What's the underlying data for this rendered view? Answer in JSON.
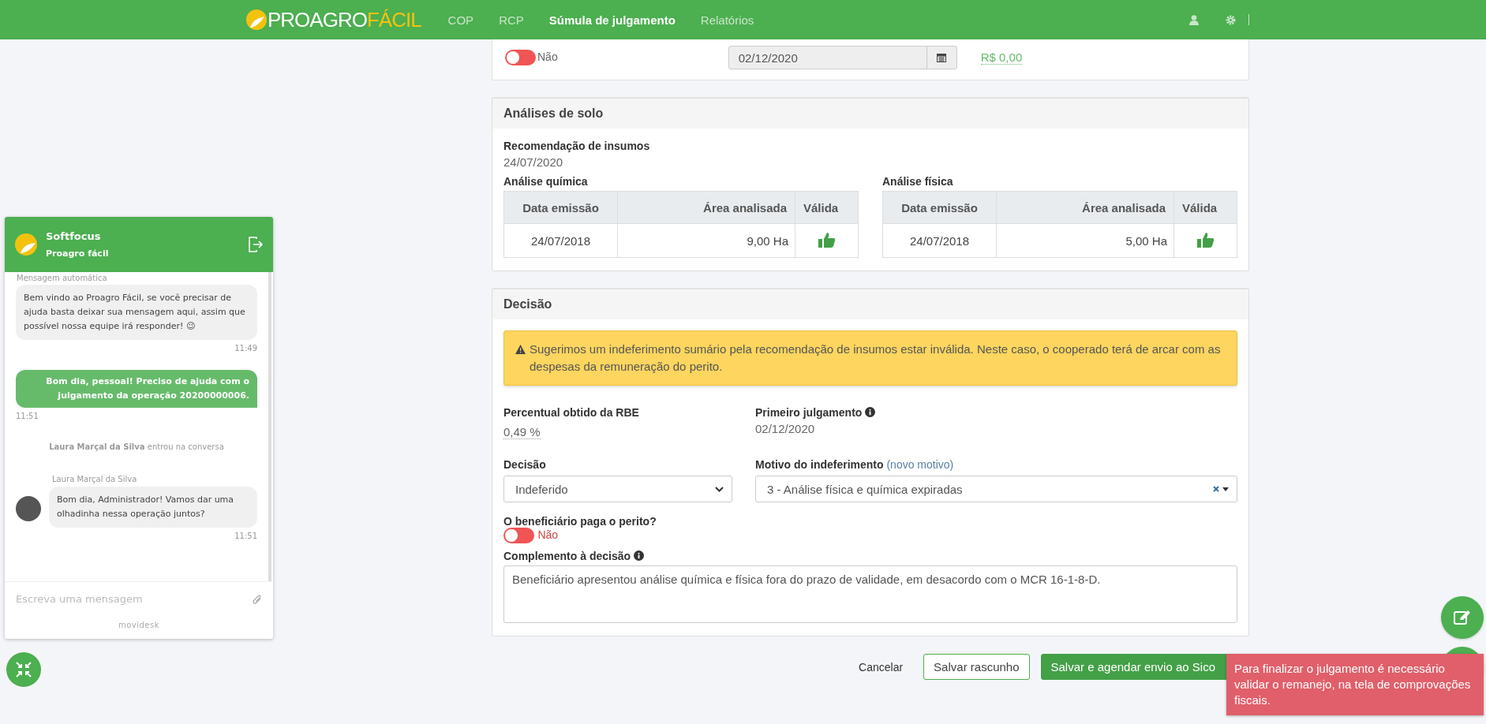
{
  "nav": {
    "logo": {
      "part1": "PROAGRO",
      "part2": "FÁCIL"
    },
    "items": [
      {
        "label": "COP",
        "selected": false
      },
      {
        "label": "RCP",
        "selected": false
      },
      {
        "label": "Súmula de julgamento",
        "selected": true
      },
      {
        "label": "Relatórios",
        "selected": false
      }
    ]
  },
  "top_card": {
    "toggle": {
      "on": false,
      "label": "Não"
    },
    "date_field": {
      "value": "02/12/2020"
    },
    "amount": "R$ 0,00"
  },
  "soil": {
    "title": "Análises de solo",
    "recommendation": {
      "label": "Recomendação de insumos",
      "value": "24/07/2020"
    },
    "tables": [
      {
        "title": "Análise química",
        "columns": [
          "Data emissão",
          "Área analisada",
          "Válida"
        ],
        "rows": [
          {
            "date": "24/07/2018",
            "area": "9,00 Ha",
            "valid": true
          }
        ]
      },
      {
        "title": "Análise física",
        "columns": [
          "Data emissão",
          "Área analisada",
          "Válida"
        ],
        "rows": [
          {
            "date": "24/07/2018",
            "area": "5,00 Ha",
            "valid": true
          }
        ]
      }
    ]
  },
  "decision": {
    "title": "Decisão",
    "alert": "Sugerimos um indeferimento sumário pela recomendação de insumos estar inválida. Neste caso, o cooperado terá de arcar com as despesas da remuneração do perito.",
    "percent": {
      "label": "Percentual obtido da RBE",
      "value": "0,49 %"
    },
    "first_judgment": {
      "label": "Primeiro julgamento",
      "value": "02/12/2020"
    },
    "decision_select": {
      "label": "Decisão",
      "value": "Indeferido"
    },
    "reason": {
      "label": "Motivo do indeferimento",
      "link": "(novo motivo)",
      "value": "3 - Análise física e química expiradas"
    },
    "pays_expert": {
      "label": "O beneficiário paga o perito?",
      "on": false,
      "state_label": "Não"
    },
    "complement": {
      "label": "Complemento à decisão",
      "value": "Beneficiário apresentou análise química e física fora do prazo de validade, em desacordo com o MCR 16-1-8-D."
    }
  },
  "actions": [
    {
      "label": "Cancelar",
      "kind": "link"
    },
    {
      "label": "Salvar rascunho",
      "kind": "outline"
    },
    {
      "label": "Salvar e agendar envio ao Sico",
      "kind": "primary"
    }
  ],
  "toast": "Para finalizar o julgamento é necessário validar o remanejo, na tela de comprovações fiscais.",
  "chat": {
    "title": "Softfocus",
    "subtitle": "Proagro fácil",
    "auto_label": "Mensagem automática",
    "messages": [
      {
        "kind": "bot",
        "text": "Bem vindo ao Proagro Fácil, se você precisar de ajuda basta deixar sua mensagem aqui, assim que possível nossa equipe irá responder! 😉",
        "time": "11:49"
      },
      {
        "kind": "user",
        "text": "Bom dia, pessoal! Preciso de ajuda com o julgamento da operação 20200000006.",
        "time": "11:51"
      },
      {
        "kind": "system",
        "text": "**Laura Marçal da Silva** entrou na conversa"
      },
      {
        "kind": "agent",
        "sender": "Laura Marçal da Silva",
        "text": "Bom dia, Administrador! Vamos dar uma olhadinha nessa operação juntos?",
        "time": "11:51"
      }
    ],
    "placeholder": "Escreva uma mensagem",
    "brand": "movidesk"
  }
}
